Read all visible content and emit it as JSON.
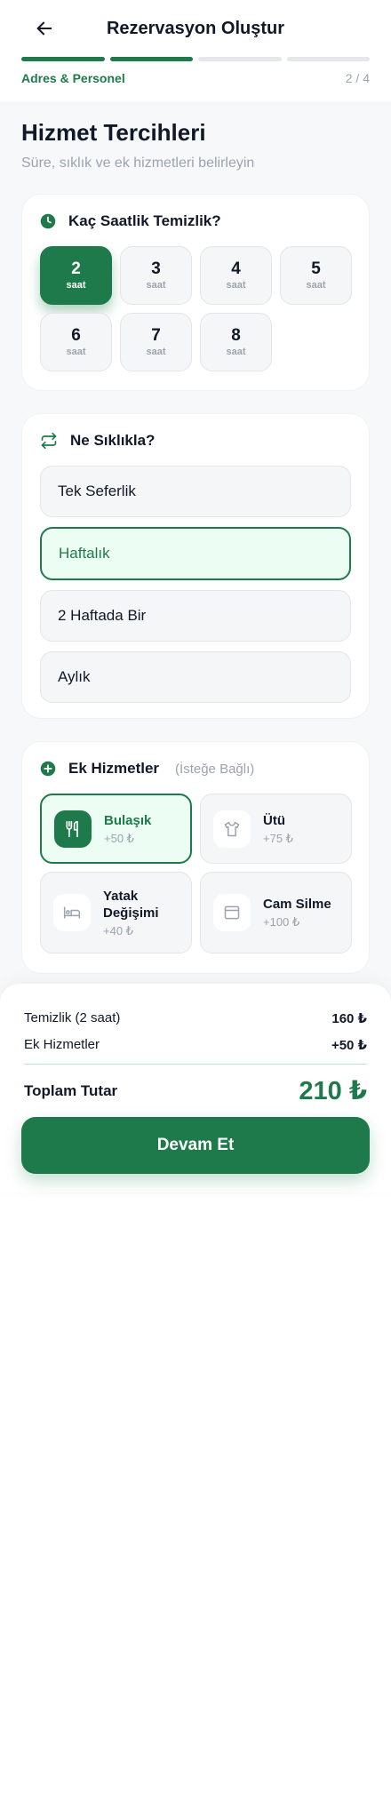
{
  "header": {
    "title": "Rezervasyon Oluştur",
    "step_label": "Adres & Personel",
    "step_count": "2 / 4",
    "progress_segments": 4,
    "progress_active": 2
  },
  "intro": {
    "title": "Hizmet Tercihleri",
    "subtitle": "Süre, sıklık ve ek hizmetleri belirleyin"
  },
  "hours_section": {
    "title": "Kaç Saatlik Temizlik?",
    "icon": "clock-icon",
    "options": [
      {
        "value": "2",
        "unit": "saat",
        "selected": true
      },
      {
        "value": "3",
        "unit": "saat",
        "selected": false
      },
      {
        "value": "4",
        "unit": "saat",
        "selected": false
      },
      {
        "value": "5",
        "unit": "saat",
        "selected": false
      },
      {
        "value": "6",
        "unit": "saat",
        "selected": false
      },
      {
        "value": "7",
        "unit": "saat",
        "selected": false
      },
      {
        "value": "8",
        "unit": "saat",
        "selected": false
      }
    ]
  },
  "frequency_section": {
    "title": "Ne Sıklıkla?",
    "icon": "repeat-icon",
    "options": [
      {
        "label": "Tek Seferlik",
        "selected": false
      },
      {
        "label": "Haftalık",
        "selected": true
      },
      {
        "label": "2 Haftada Bir",
        "selected": false
      },
      {
        "label": "Aylık",
        "selected": false
      }
    ]
  },
  "extras_section": {
    "title": "Ek Hizmetler",
    "optional": "(İsteğe Bağlı)",
    "icon": "plus-circle-icon",
    "options": [
      {
        "name": "Bulaşık",
        "price": "+50 ₺",
        "icon": "utensils-icon",
        "selected": true
      },
      {
        "name": "Ütü",
        "price": "+75 ₺",
        "icon": "shirt-icon",
        "selected": false
      },
      {
        "name": "Yatak Değişimi",
        "price": "+40 ₺",
        "icon": "bed-icon",
        "selected": false
      },
      {
        "name": "Cam Silme",
        "price": "+100 ₺",
        "icon": "window-icon",
        "selected": false
      }
    ]
  },
  "summary": {
    "cleaning_label": "Temizlik (2 saat)",
    "cleaning_value": "160 ₺",
    "extras_label": "Ek Hizmetler",
    "extras_value": "+50 ₺",
    "total_label": "Toplam Tutar",
    "total_value": "210 ₺",
    "cta_label": "Devam Et"
  },
  "colors": {
    "accent": "#1e7a4a",
    "accent_light": "#ecfdf3",
    "muted": "#9ca3af"
  }
}
